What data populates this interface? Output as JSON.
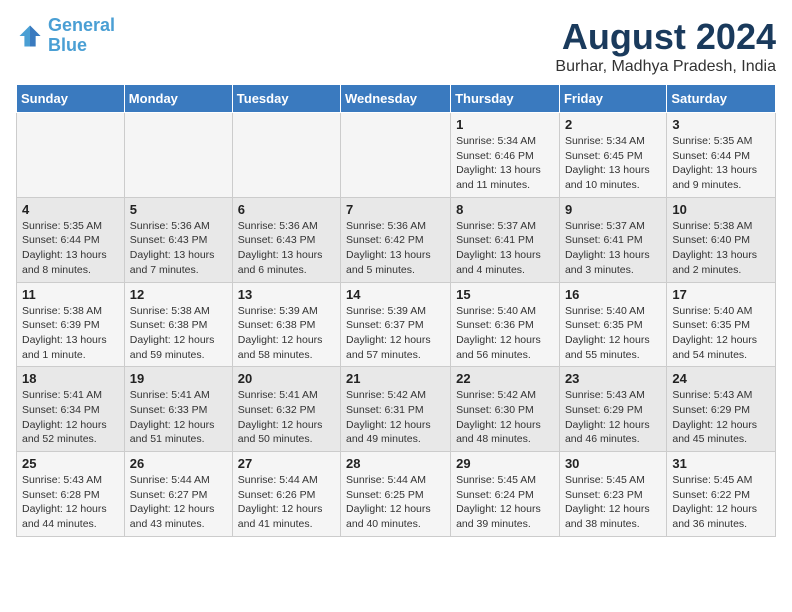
{
  "logo": {
    "line1": "General",
    "line2": "Blue"
  },
  "title": "August 2024",
  "subtitle": "Burhar, Madhya Pradesh, India",
  "days_of_week": [
    "Sunday",
    "Monday",
    "Tuesday",
    "Wednesday",
    "Thursday",
    "Friday",
    "Saturday"
  ],
  "weeks": [
    [
      {
        "day": "",
        "info": ""
      },
      {
        "day": "",
        "info": ""
      },
      {
        "day": "",
        "info": ""
      },
      {
        "day": "",
        "info": ""
      },
      {
        "day": "1",
        "info": "Sunrise: 5:34 AM\nSunset: 6:46 PM\nDaylight: 13 hours and 11 minutes."
      },
      {
        "day": "2",
        "info": "Sunrise: 5:34 AM\nSunset: 6:45 PM\nDaylight: 13 hours and 10 minutes."
      },
      {
        "day": "3",
        "info": "Sunrise: 5:35 AM\nSunset: 6:44 PM\nDaylight: 13 hours and 9 minutes."
      }
    ],
    [
      {
        "day": "4",
        "info": "Sunrise: 5:35 AM\nSunset: 6:44 PM\nDaylight: 13 hours and 8 minutes."
      },
      {
        "day": "5",
        "info": "Sunrise: 5:36 AM\nSunset: 6:43 PM\nDaylight: 13 hours and 7 minutes."
      },
      {
        "day": "6",
        "info": "Sunrise: 5:36 AM\nSunset: 6:43 PM\nDaylight: 13 hours and 6 minutes."
      },
      {
        "day": "7",
        "info": "Sunrise: 5:36 AM\nSunset: 6:42 PM\nDaylight: 13 hours and 5 minutes."
      },
      {
        "day": "8",
        "info": "Sunrise: 5:37 AM\nSunset: 6:41 PM\nDaylight: 13 hours and 4 minutes."
      },
      {
        "day": "9",
        "info": "Sunrise: 5:37 AM\nSunset: 6:41 PM\nDaylight: 13 hours and 3 minutes."
      },
      {
        "day": "10",
        "info": "Sunrise: 5:38 AM\nSunset: 6:40 PM\nDaylight: 13 hours and 2 minutes."
      }
    ],
    [
      {
        "day": "11",
        "info": "Sunrise: 5:38 AM\nSunset: 6:39 PM\nDaylight: 13 hours and 1 minute."
      },
      {
        "day": "12",
        "info": "Sunrise: 5:38 AM\nSunset: 6:38 PM\nDaylight: 12 hours and 59 minutes."
      },
      {
        "day": "13",
        "info": "Sunrise: 5:39 AM\nSunset: 6:38 PM\nDaylight: 12 hours and 58 minutes."
      },
      {
        "day": "14",
        "info": "Sunrise: 5:39 AM\nSunset: 6:37 PM\nDaylight: 12 hours and 57 minutes."
      },
      {
        "day": "15",
        "info": "Sunrise: 5:40 AM\nSunset: 6:36 PM\nDaylight: 12 hours and 56 minutes."
      },
      {
        "day": "16",
        "info": "Sunrise: 5:40 AM\nSunset: 6:35 PM\nDaylight: 12 hours and 55 minutes."
      },
      {
        "day": "17",
        "info": "Sunrise: 5:40 AM\nSunset: 6:35 PM\nDaylight: 12 hours and 54 minutes."
      }
    ],
    [
      {
        "day": "18",
        "info": "Sunrise: 5:41 AM\nSunset: 6:34 PM\nDaylight: 12 hours and 52 minutes."
      },
      {
        "day": "19",
        "info": "Sunrise: 5:41 AM\nSunset: 6:33 PM\nDaylight: 12 hours and 51 minutes."
      },
      {
        "day": "20",
        "info": "Sunrise: 5:41 AM\nSunset: 6:32 PM\nDaylight: 12 hours and 50 minutes."
      },
      {
        "day": "21",
        "info": "Sunrise: 5:42 AM\nSunset: 6:31 PM\nDaylight: 12 hours and 49 minutes."
      },
      {
        "day": "22",
        "info": "Sunrise: 5:42 AM\nSunset: 6:30 PM\nDaylight: 12 hours and 48 minutes."
      },
      {
        "day": "23",
        "info": "Sunrise: 5:43 AM\nSunset: 6:29 PM\nDaylight: 12 hours and 46 minutes."
      },
      {
        "day": "24",
        "info": "Sunrise: 5:43 AM\nSunset: 6:29 PM\nDaylight: 12 hours and 45 minutes."
      }
    ],
    [
      {
        "day": "25",
        "info": "Sunrise: 5:43 AM\nSunset: 6:28 PM\nDaylight: 12 hours and 44 minutes."
      },
      {
        "day": "26",
        "info": "Sunrise: 5:44 AM\nSunset: 6:27 PM\nDaylight: 12 hours and 43 minutes."
      },
      {
        "day": "27",
        "info": "Sunrise: 5:44 AM\nSunset: 6:26 PM\nDaylight: 12 hours and 41 minutes."
      },
      {
        "day": "28",
        "info": "Sunrise: 5:44 AM\nSunset: 6:25 PM\nDaylight: 12 hours and 40 minutes."
      },
      {
        "day": "29",
        "info": "Sunrise: 5:45 AM\nSunset: 6:24 PM\nDaylight: 12 hours and 39 minutes."
      },
      {
        "day": "30",
        "info": "Sunrise: 5:45 AM\nSunset: 6:23 PM\nDaylight: 12 hours and 38 minutes."
      },
      {
        "day": "31",
        "info": "Sunrise: 5:45 AM\nSunset: 6:22 PM\nDaylight: 12 hours and 36 minutes."
      }
    ]
  ]
}
